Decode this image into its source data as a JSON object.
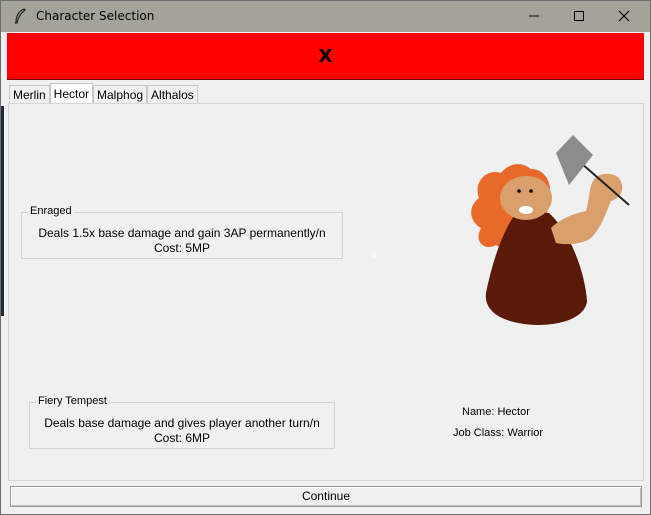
{
  "window": {
    "title": "Character Selection"
  },
  "banner": {
    "text": "X",
    "color": "#ff0000"
  },
  "tabs": [
    {
      "label": "Merlin",
      "active": false
    },
    {
      "label": "Hector",
      "active": true
    },
    {
      "label": "Malphog",
      "active": false
    },
    {
      "label": "Althalos",
      "active": false
    }
  ],
  "skills": [
    {
      "name": "Enraged",
      "description": "Deals 1.5x base damage and gain 3AP permanently/n",
      "cost": "Cost: 5MP"
    },
    {
      "name": "Fiery Tempest",
      "description": "Deals base damage and gives player another turn/n",
      "cost": "Cost: 6MP"
    }
  ],
  "character": {
    "name": "Name: Hector",
    "job_class": "Job Class: Warrior",
    "colors": {
      "hair": "#e8692a",
      "skin": "#d9a06e",
      "robe": "#5a1a0a",
      "axe_blade": "#8c8c8c"
    }
  },
  "footer": {
    "continue_label": "Continue"
  },
  "icons": {
    "app": "feather-icon",
    "minimize": "minimize-icon",
    "maximize": "maximize-icon",
    "close": "close-icon"
  }
}
